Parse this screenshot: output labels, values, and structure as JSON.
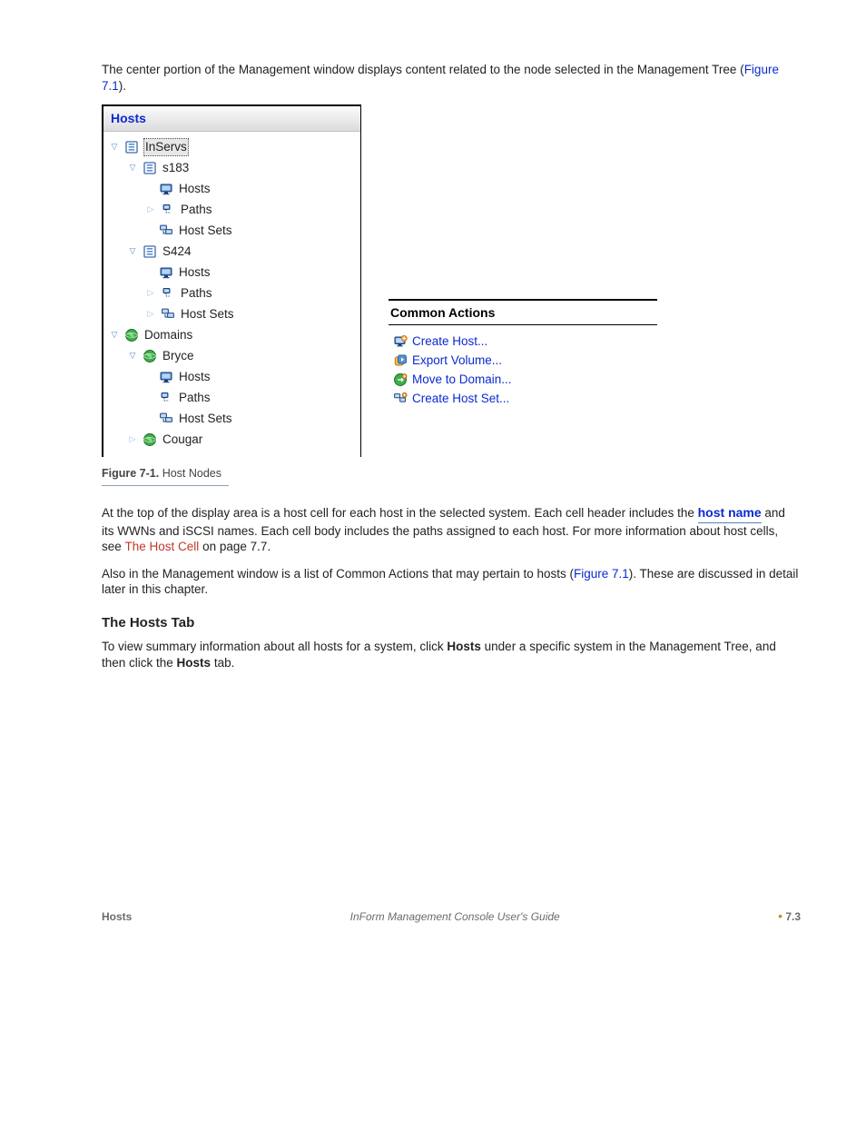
{
  "page": {
    "chapter_ref": "Figure 7.1",
    "body_intro": "The center portion of the Management window displays content related to the node selected in the Management Tree (",
    "body_intro_ref": "Figure 7.1",
    "body_intro_end": ").",
    "after_fig": "At the top of the display area is a host cell for each host in the selected system. Each cell header includes the ",
    "hname_word": "host name",
    "after_fig_2": " and its WWNs and iSCSI names. Each cell body includes the paths assigned to each host. For more information about host cells, see ",
    "hc_ref": "The Host Cell",
    "hc_page": " on page 7.7.",
    "after_fig_3": "Also in the Management window is a list of Common Actions that may pertain to hosts (",
    "after_fig_3_ref": "Figure 7.1",
    "after_fig_3_end": "). These are discussed in detail later in this chapter."
  },
  "tree": {
    "header": "Hosts",
    "inservs": {
      "label": "InServs",
      "s183": {
        "label": "s183",
        "hosts": "Hosts",
        "paths": "Paths",
        "hostsets": "Host Sets"
      },
      "s424": {
        "label": "S424",
        "hosts": "Hosts",
        "paths": "Paths",
        "hostsets": "Host Sets"
      }
    },
    "domains": {
      "label": "Domains",
      "bryce": {
        "label": "Bryce",
        "hosts": "Hosts",
        "paths": "Paths",
        "hostsets": "Host Sets"
      },
      "cougar": {
        "label": "Cougar"
      }
    }
  },
  "actions": {
    "header": "Common Actions",
    "create_host": "Create Host...",
    "export_vol": "Export Volume...",
    "move_domain": "Move to Domain...",
    "create_hs": "Create Host Set..."
  },
  "caption": {
    "fignum": "Figure 7-1.",
    "figtext": " Host Nodes"
  },
  "sec": {
    "h1": "The Hosts Tab",
    "p1_a": "To view summary information about all hosts for a system, click ",
    "p1_b": "Hosts",
    "p1_c": " under a specific system in the Management Tree, and then click the ",
    "p1_d": "Hosts",
    "p1_e": " tab."
  },
  "footer": {
    "left": "Hosts",
    "mid": "InForm Management Console User's Guide",
    "right_dot": "•",
    "right": "7.3"
  }
}
